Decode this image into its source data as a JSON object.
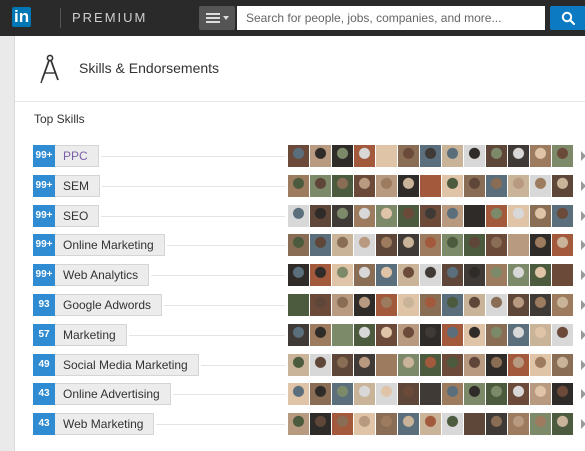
{
  "header": {
    "logo_text": "in",
    "premium_label": "PREMIUM",
    "search_placeholder": "Search for people, jobs, companies, and more..."
  },
  "section": {
    "title": "Skills & Endorsements",
    "top_skills_label": "Top Skills"
  },
  "skills": [
    {
      "count": "99+",
      "name": "PPC"
    },
    {
      "count": "99+",
      "name": "SEM"
    },
    {
      "count": "99+",
      "name": "SEO"
    },
    {
      "count": "99+",
      "name": "Online Marketing"
    },
    {
      "count": "99+",
      "name": "Web Analytics"
    },
    {
      "count": "93",
      "name": "Google Adwords"
    },
    {
      "count": "57",
      "name": "Marketing"
    },
    {
      "count": "49",
      "name": "Social Media Marketing"
    },
    {
      "count": "43",
      "name": "Online Advertising"
    },
    {
      "count": "43",
      "name": "Web Marketing"
    }
  ],
  "avatar_palette": [
    "#6b4a3a",
    "#8a6d55",
    "#3f3a36",
    "#b89a80",
    "#5a6e7c",
    "#9c7b5e",
    "#2f2b28",
    "#c9b49a",
    "#7d8a6a",
    "#a35a3c",
    "#d8d8d8",
    "#4c5a3e",
    "#e0c4a8",
    "#5e4638"
  ],
  "colors": {
    "accent": "#2f8bd2",
    "topbar": "#2a2a2a",
    "link_skill": "#7a5fa8"
  }
}
